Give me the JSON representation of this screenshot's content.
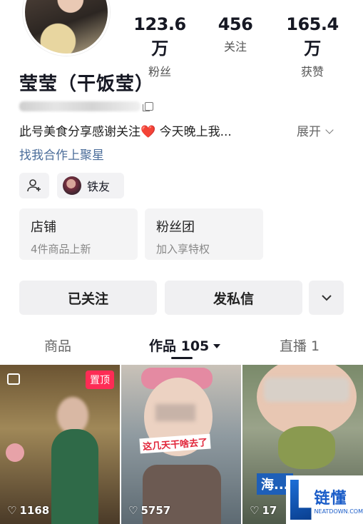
{
  "stats": [
    {
      "value": "123.6万",
      "label": "粉丝"
    },
    {
      "value": "456",
      "label": "关注"
    },
    {
      "value": "165.4万",
      "label": "获赞"
    }
  ],
  "profile": {
    "name": "莹莹（干饭莹）",
    "bio": "此号美食分享感谢关注❤️ 今天晚上我...",
    "expand_label": "展开",
    "link_text": "找我合作上聚星"
  },
  "chips": {
    "friend_label": "铁友"
  },
  "cards": [
    {
      "title": "店铺",
      "subtitle": "4件商品上新"
    },
    {
      "title": "粉丝团",
      "subtitle": "加入享特权"
    }
  ],
  "buttons": {
    "following": "已关注",
    "message": "发私信"
  },
  "tabs": [
    {
      "label": "商品"
    },
    {
      "label": "作品 105"
    },
    {
      "label": "直播 1"
    }
  ],
  "videos": [
    {
      "likes": "1168",
      "pinned_label": "置顶"
    },
    {
      "likes": "5757",
      "caption": "这几天干啥去了"
    },
    {
      "likes": "17",
      "caption": "海..."
    }
  ],
  "watermark": {
    "text": "链懂",
    "url": "NEATDOWN.COM"
  },
  "colors": {
    "accent": "#fe2c55",
    "link": "#4b6d9a"
  }
}
